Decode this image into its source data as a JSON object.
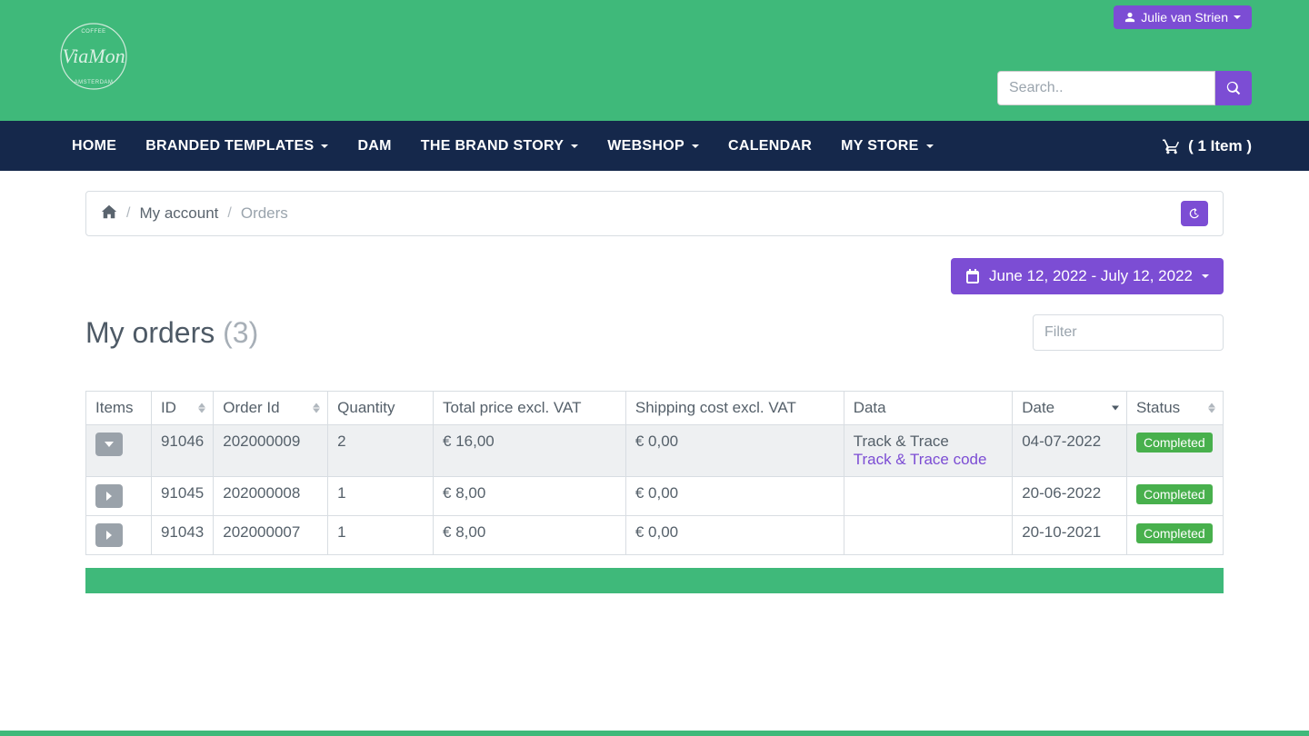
{
  "user": {
    "name": "Julie van Strien"
  },
  "search": {
    "placeholder": "Search.."
  },
  "nav": {
    "items": [
      {
        "label": "HOME",
        "caret": false
      },
      {
        "label": "BRANDED TEMPLATES",
        "caret": true
      },
      {
        "label": "DAM",
        "caret": false
      },
      {
        "label": "THE BRAND STORY",
        "caret": true
      },
      {
        "label": "WEBSHOP",
        "caret": true
      },
      {
        "label": "CALENDAR",
        "caret": false
      },
      {
        "label": "MY STORE",
        "caret": true
      }
    ],
    "cart_label": "( 1 Item )"
  },
  "breadcrumb": {
    "my_account": "My account",
    "orders": "Orders"
  },
  "date_range": "June 12, 2022 - July 12, 2022",
  "page": {
    "title": "My orders",
    "count": "(3)",
    "filter_placeholder": "Filter"
  },
  "table": {
    "headers": {
      "items": "Items",
      "id": "ID",
      "order_id": "Order Id",
      "quantity": "Quantity",
      "total": "Total price excl. VAT",
      "shipping": "Shipping cost excl. VAT",
      "data": "Data",
      "date": "Date",
      "status": "Status"
    },
    "track_trace_label": "Track & Trace",
    "track_trace_link": "Track & Trace code",
    "rows": [
      {
        "id": "91046",
        "order_id": "202000009",
        "quantity": "2",
        "total": "€ 16,00",
        "shipping": "€ 0,00",
        "has_track": true,
        "date": "04-07-2022",
        "status": "Completed"
      },
      {
        "id": "91045",
        "order_id": "202000008",
        "quantity": "1",
        "total": "€ 8,00",
        "shipping": "€ 0,00",
        "has_track": false,
        "date": "20-06-2022",
        "status": "Completed"
      },
      {
        "id": "91043",
        "order_id": "202000007",
        "quantity": "1",
        "total": "€ 8,00",
        "shipping": "€ 0,00",
        "has_track": false,
        "date": "20-10-2021",
        "status": "Completed"
      }
    ]
  }
}
